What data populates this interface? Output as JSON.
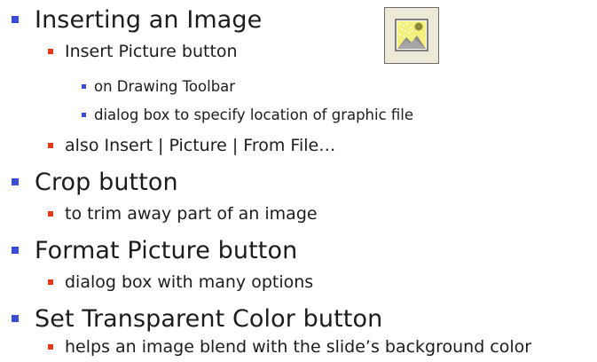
{
  "slide": {
    "items": [
      {
        "label": "Inserting an Image",
        "children": [
          {
            "label": "Insert Picture button",
            "children": [
              {
                "label": "on Drawing Toolbar"
              },
              {
                "label": "dialog box to specify location of graphic file"
              }
            ]
          },
          {
            "label": "also Insert | Picture | From File…"
          }
        ]
      },
      {
        "label": "Crop button",
        "children": [
          {
            "label": "to trim away part of an image"
          }
        ]
      },
      {
        "label": "Format Picture button",
        "children": [
          {
            "label": "dialog box with many options"
          }
        ]
      },
      {
        "label": "Set Transparent Color button",
        "children": [
          {
            "label": "helps an image blend with the slide’s background color"
          }
        ]
      }
    ]
  },
  "icon": {
    "name": "insert-picture-icon",
    "colors": {
      "frame_bg": "#ece9d8",
      "sky": "#f4f080",
      "sun": "#8a8a3a",
      "mountain": "#8a8a8a",
      "border": "#6b6b6b"
    }
  },
  "colors": {
    "level1_bullet": "#3a4cd6",
    "level2_bullet": "#e23a16",
    "level3_bullet": "#3a4cd6",
    "text": "#1c1c1c"
  }
}
